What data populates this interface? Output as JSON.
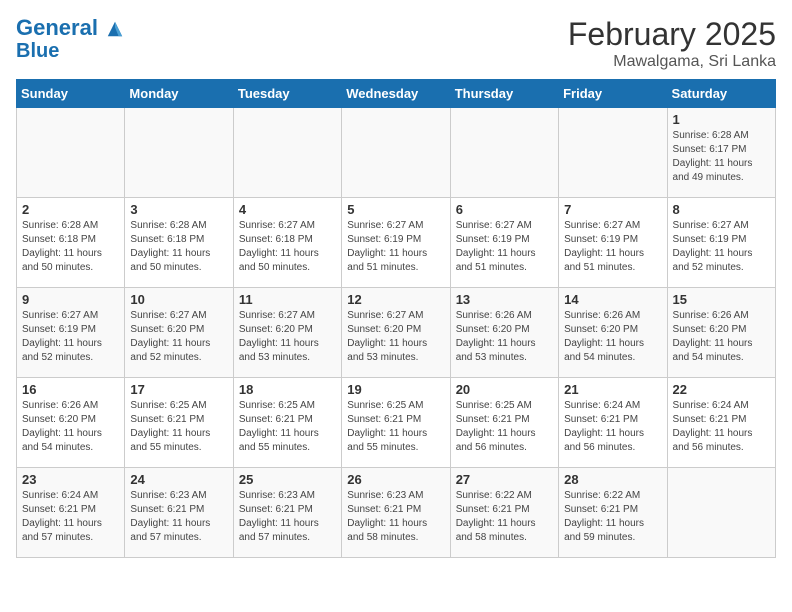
{
  "header": {
    "logo_line1": "General",
    "logo_line2": "Blue",
    "title": "February 2025",
    "subtitle": "Mawalgama, Sri Lanka"
  },
  "weekdays": [
    "Sunday",
    "Monday",
    "Tuesday",
    "Wednesday",
    "Thursday",
    "Friday",
    "Saturday"
  ],
  "weeks": [
    [
      {
        "day": "",
        "info": ""
      },
      {
        "day": "",
        "info": ""
      },
      {
        "day": "",
        "info": ""
      },
      {
        "day": "",
        "info": ""
      },
      {
        "day": "",
        "info": ""
      },
      {
        "day": "",
        "info": ""
      },
      {
        "day": "1",
        "info": "Sunrise: 6:28 AM\nSunset: 6:17 PM\nDaylight: 11 hours and 49 minutes."
      }
    ],
    [
      {
        "day": "2",
        "info": "Sunrise: 6:28 AM\nSunset: 6:18 PM\nDaylight: 11 hours and 50 minutes."
      },
      {
        "day": "3",
        "info": "Sunrise: 6:28 AM\nSunset: 6:18 PM\nDaylight: 11 hours and 50 minutes."
      },
      {
        "day": "4",
        "info": "Sunrise: 6:27 AM\nSunset: 6:18 PM\nDaylight: 11 hours and 50 minutes."
      },
      {
        "day": "5",
        "info": "Sunrise: 6:27 AM\nSunset: 6:19 PM\nDaylight: 11 hours and 51 minutes."
      },
      {
        "day": "6",
        "info": "Sunrise: 6:27 AM\nSunset: 6:19 PM\nDaylight: 11 hours and 51 minutes."
      },
      {
        "day": "7",
        "info": "Sunrise: 6:27 AM\nSunset: 6:19 PM\nDaylight: 11 hours and 51 minutes."
      },
      {
        "day": "8",
        "info": "Sunrise: 6:27 AM\nSunset: 6:19 PM\nDaylight: 11 hours and 52 minutes."
      }
    ],
    [
      {
        "day": "9",
        "info": "Sunrise: 6:27 AM\nSunset: 6:19 PM\nDaylight: 11 hours and 52 minutes."
      },
      {
        "day": "10",
        "info": "Sunrise: 6:27 AM\nSunset: 6:20 PM\nDaylight: 11 hours and 52 minutes."
      },
      {
        "day": "11",
        "info": "Sunrise: 6:27 AM\nSunset: 6:20 PM\nDaylight: 11 hours and 53 minutes."
      },
      {
        "day": "12",
        "info": "Sunrise: 6:27 AM\nSunset: 6:20 PM\nDaylight: 11 hours and 53 minutes."
      },
      {
        "day": "13",
        "info": "Sunrise: 6:26 AM\nSunset: 6:20 PM\nDaylight: 11 hours and 53 minutes."
      },
      {
        "day": "14",
        "info": "Sunrise: 6:26 AM\nSunset: 6:20 PM\nDaylight: 11 hours and 54 minutes."
      },
      {
        "day": "15",
        "info": "Sunrise: 6:26 AM\nSunset: 6:20 PM\nDaylight: 11 hours and 54 minutes."
      }
    ],
    [
      {
        "day": "16",
        "info": "Sunrise: 6:26 AM\nSunset: 6:20 PM\nDaylight: 11 hours and 54 minutes."
      },
      {
        "day": "17",
        "info": "Sunrise: 6:25 AM\nSunset: 6:21 PM\nDaylight: 11 hours and 55 minutes."
      },
      {
        "day": "18",
        "info": "Sunrise: 6:25 AM\nSunset: 6:21 PM\nDaylight: 11 hours and 55 minutes."
      },
      {
        "day": "19",
        "info": "Sunrise: 6:25 AM\nSunset: 6:21 PM\nDaylight: 11 hours and 55 minutes."
      },
      {
        "day": "20",
        "info": "Sunrise: 6:25 AM\nSunset: 6:21 PM\nDaylight: 11 hours and 56 minutes."
      },
      {
        "day": "21",
        "info": "Sunrise: 6:24 AM\nSunset: 6:21 PM\nDaylight: 11 hours and 56 minutes."
      },
      {
        "day": "22",
        "info": "Sunrise: 6:24 AM\nSunset: 6:21 PM\nDaylight: 11 hours and 56 minutes."
      }
    ],
    [
      {
        "day": "23",
        "info": "Sunrise: 6:24 AM\nSunset: 6:21 PM\nDaylight: 11 hours and 57 minutes."
      },
      {
        "day": "24",
        "info": "Sunrise: 6:23 AM\nSunset: 6:21 PM\nDaylight: 11 hours and 57 minutes."
      },
      {
        "day": "25",
        "info": "Sunrise: 6:23 AM\nSunset: 6:21 PM\nDaylight: 11 hours and 57 minutes."
      },
      {
        "day": "26",
        "info": "Sunrise: 6:23 AM\nSunset: 6:21 PM\nDaylight: 11 hours and 58 minutes."
      },
      {
        "day": "27",
        "info": "Sunrise: 6:22 AM\nSunset: 6:21 PM\nDaylight: 11 hours and 58 minutes."
      },
      {
        "day": "28",
        "info": "Sunrise: 6:22 AM\nSunset: 6:21 PM\nDaylight: 11 hours and 59 minutes."
      },
      {
        "day": "",
        "info": ""
      }
    ]
  ]
}
